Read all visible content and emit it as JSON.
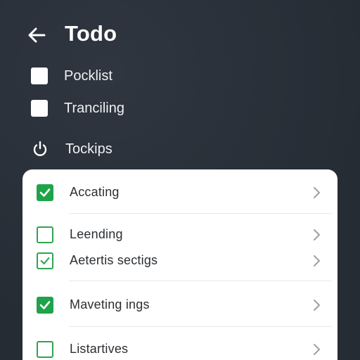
{
  "header": {
    "title": "Todo",
    "back_icon": "arrow-left-icon"
  },
  "top_items": [
    {
      "label": "Pocklist",
      "icon": "checkbox-white"
    },
    {
      "label": "Tranciling",
      "icon": "checkbox-white"
    },
    {
      "label": "Tockips",
      "icon": "power-icon"
    }
  ],
  "list": {
    "items": [
      {
        "label": "Accating",
        "state": "checked"
      },
      {
        "label": "Leending",
        "state": "unchecked"
      },
      {
        "label": "Aetertis sectigs",
        "state": "checked-outline"
      },
      {
        "label": "Maveting ings",
        "state": "checked"
      },
      {
        "label": "Listartives",
        "state": "unchecked"
      }
    ],
    "chevron_icon": "chevron-right-icon"
  },
  "colors": {
    "background": "#2a313a",
    "accent_green": "#1fa34a",
    "card": "#ffffff"
  }
}
